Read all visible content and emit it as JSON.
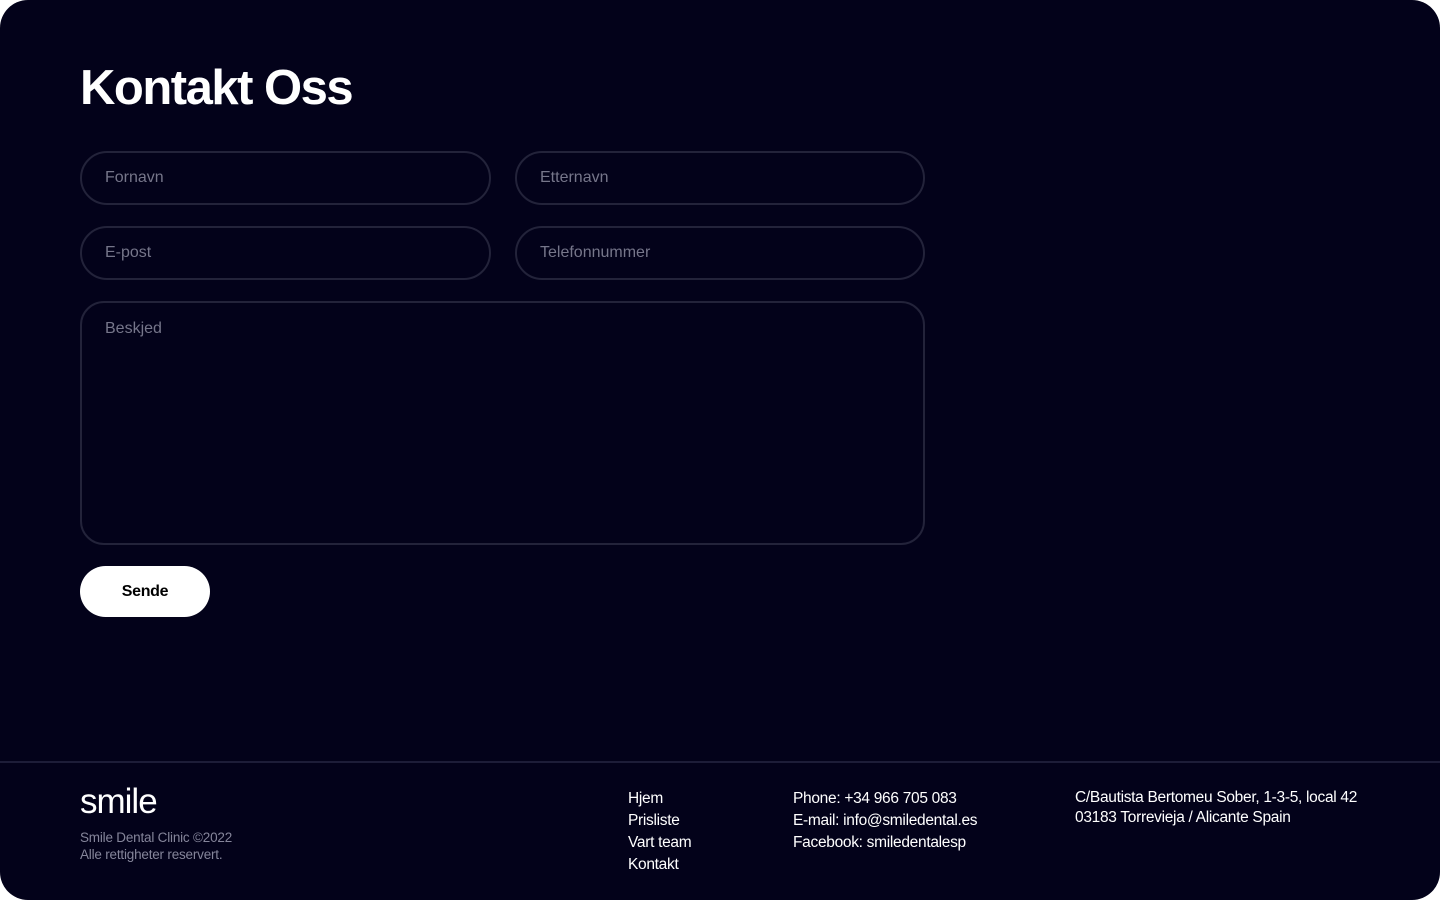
{
  "contact_form": {
    "title": "Kontakt Oss",
    "first_name_placeholder": "Fornavn",
    "last_name_placeholder": "Etternavn",
    "email_placeholder": "E-post",
    "phone_placeholder": "Telefonnummer",
    "message_placeholder": "Beskjed",
    "submit_label": "Sende"
  },
  "footer": {
    "logo_text": "smile",
    "copyright_line1": "Smile Dental Clinic ©2022",
    "copyright_line2": "Alle rettigheter reservert.",
    "nav_items": [
      "Hjem",
      "Prisliste",
      "Vart team",
      "Kontakt"
    ],
    "contact": {
      "phone": "Phone: +34 966 705 083",
      "email": "E-mail: info@smiledental.es",
      "facebook": "Facebook: smiledentalesp"
    },
    "address": {
      "line1": "C/Bautista Bertomeu Sober, 1-3-5, local 42",
      "line2": "03183 Torrevieja / Alicante Spain"
    }
  },
  "colors": {
    "background": "#03021a",
    "field_border": "#23233a",
    "placeholder": "#76768a",
    "button_bg": "#ffffff",
    "button_text": "#000000",
    "muted_text": "#85859a"
  }
}
